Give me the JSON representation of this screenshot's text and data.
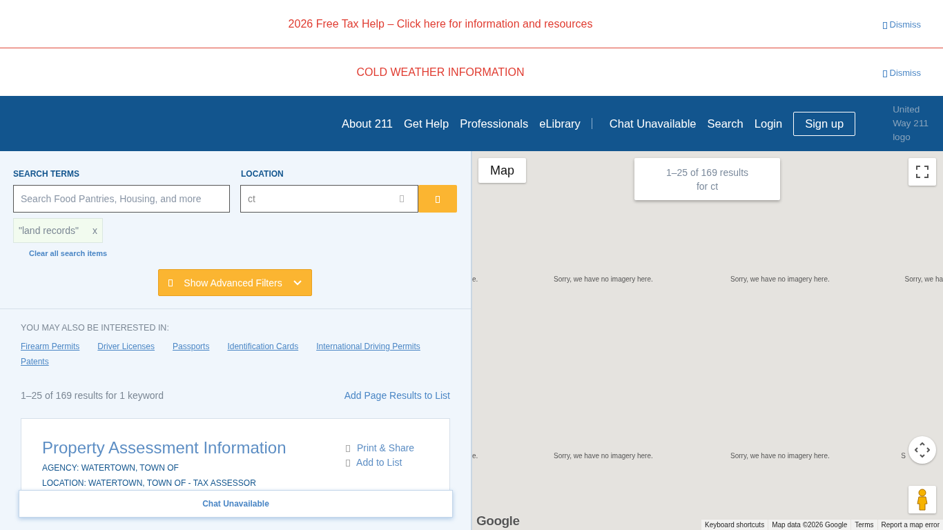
{
  "alerts": [
    {
      "text": "2026 Free Tax Help – Click here for information and resources",
      "dismiss": "Dismiss"
    },
    {
      "text": "COLD WEATHER INFORMATION",
      "dismiss": "Dismiss"
    }
  ],
  "nav": {
    "items": [
      "About 211",
      "Get Help",
      "Professionals",
      "eLibrary"
    ],
    "items_right": [
      "Chat Unavailable",
      "Search",
      "Login"
    ],
    "signup": "Sign up",
    "logo_alt": "United Way 211 logo"
  },
  "search": {
    "terms_label": "SEARCH TERMS",
    "terms_placeholder": "Search Food Pantries, Housing, and more",
    "location_label": "LOCATION",
    "location_value": "ct",
    "chips": [
      {
        "text": "\"land records\"",
        "remove": "x"
      }
    ],
    "clear": "Clear all search items",
    "advanced": "Show Advanced Filters"
  },
  "interested": {
    "heading": "YOU MAY ALSO BE INTERESTED IN:",
    "links": [
      "Firearm Permits",
      "Driver Licenses",
      "Passports",
      "Identification Cards",
      "International Driving Permits",
      "Patents"
    ]
  },
  "results": {
    "summary": "1–25 of 169 results for 1 keyword",
    "add_page": "Add Page Results to List",
    "items": [
      {
        "title": "Property Assessment Information",
        "agency": "AGENCY: WATERTOWN, TOWN OF",
        "location": "LOCATION: WATERTOWN, TOWN OF - TAX ASSESSOR",
        "print": "Print & Share",
        "add": "Add to List"
      }
    ]
  },
  "chat_bar": "Chat Unavailable",
  "map": {
    "type_button": "Map",
    "summary_lines": [
      "1–25 of 169 results",
      "for ct"
    ],
    "tile_rows": [
      [
        "e.",
        "Sorry, we have no imagery here.",
        "Sorry, we have no imagery here.",
        "Sorry, we ha"
      ],
      [
        "e.",
        "Sorry, we have no imagery here.",
        "Sorry, we have no imagery here.",
        "S"
      ]
    ],
    "logo": "Google",
    "footer": [
      "Keyboard shortcuts",
      "Map data ©2026 Google",
      "Terms",
      "Report a map error"
    ]
  }
}
